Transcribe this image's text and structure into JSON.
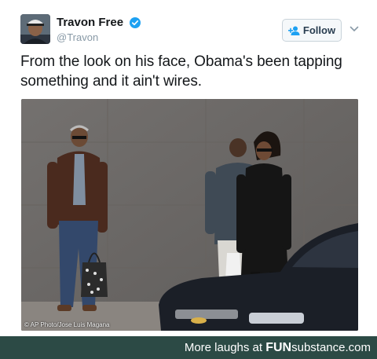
{
  "tweet": {
    "display_name": "Travon Free",
    "handle": "@Travon",
    "follow_label": "Follow",
    "text": "From the look on his face, Obama's been tapping something and it ain't wires.",
    "photo_credit": "© AP Photo/Jose Luis Magana"
  },
  "icons": {
    "verified": "verified-badge-icon",
    "follow": "add-user-icon",
    "menu": "chevron-down-icon"
  },
  "footer": {
    "prefix": "More laughs at ",
    "brand_fun": "FUN",
    "brand_rest": "substance.com"
  },
  "colors": {
    "verified_blue": "#1da1f2",
    "footer_bg": "#2c4a45",
    "handle_gray": "#8899a6"
  }
}
